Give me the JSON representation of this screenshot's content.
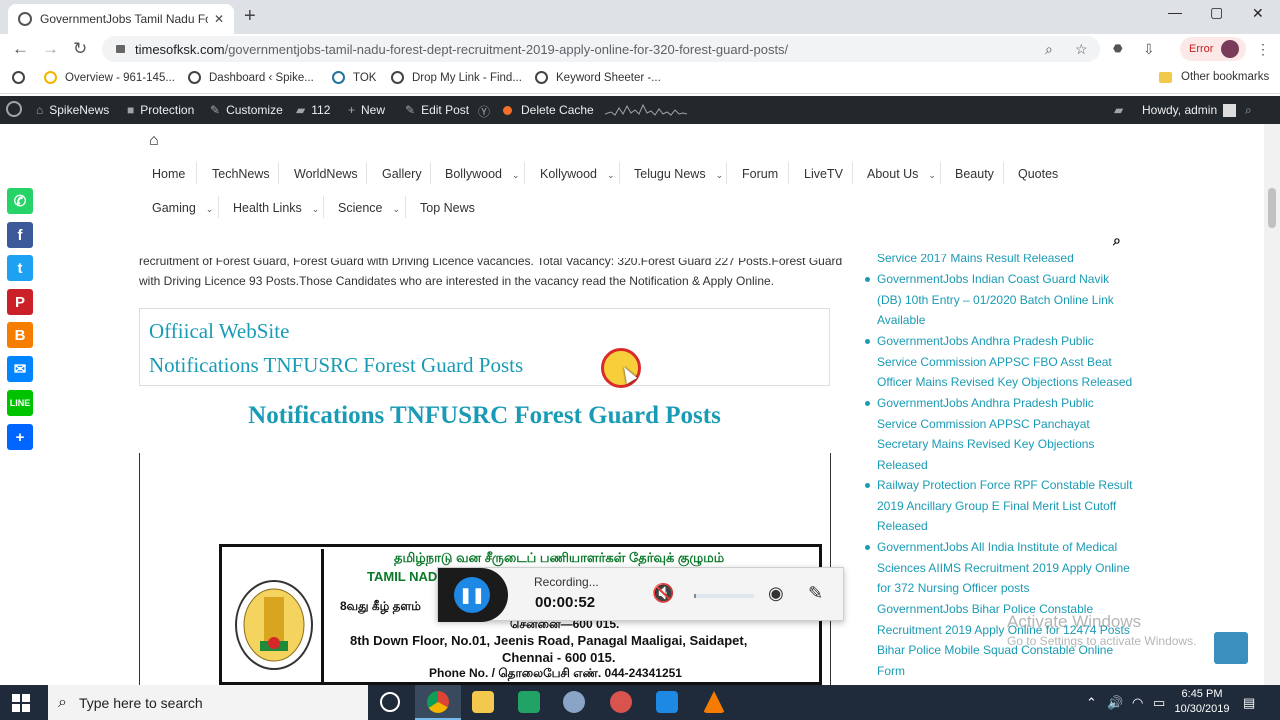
{
  "browser": {
    "tab_title": "GovernmentJobs Tamil Nadu For",
    "url_host": "timesofksk.com",
    "url_path": "/governmentjobs-tamil-nadu-forest-dept-recruitment-2019-apply-online-for-320-forest-guard-posts/",
    "error_label": "Error",
    "bookmarks": [
      "Overview - 961-145...",
      "Dashboard ‹ Spike...",
      "TOK",
      "Drop My Link - Find...",
      "Keyword Sheeter -..."
    ],
    "other_bookmarks": "Other bookmarks"
  },
  "adminbar": {
    "site": "SpikeNews",
    "protection": "Protection",
    "customize": "Customize",
    "comments": "112",
    "new": "New",
    "edit_post": "Edit Post",
    "delete_cache": "Delete Cache",
    "howdy": "Howdy, admin"
  },
  "menu": {
    "row1": [
      "Home",
      "TechNews",
      "WorldNews",
      "Gallery",
      "Bollywood",
      "Kollywood",
      "Telugu News",
      "Forum",
      "LiveTV",
      "About Us",
      "Beauty",
      "Quotes"
    ],
    "row2": [
      "Gaming",
      "Health Links",
      "Science",
      "Top News"
    ]
  },
  "article": {
    "line1": "recruitment of Forest Guard, Forest Guard with Driving Licence vacancies. Total Vacancy: 320.Forest Guard 227 Posts.Forest Guard",
    "line2": "with Driving Licence 93 Posts.Those Candidates who are interested in the vacancy read the Notification & Apply Online.",
    "official_link": "Offiical WebSite",
    "notification_link": "Notifications TNFUSRC Forest Guard Posts",
    "heading": "Notifications TNFUSRC Forest Guard Posts"
  },
  "notice": {
    "tamil_title": "தமிழ்நாடு வன சீருடைப் பணியாளர்கள் தேர்வுக் குழுமம்",
    "english_title": "TAMIL NAD",
    "floor_tamil": "8வது கீழ் தளம்",
    "city_tamil": "சென்னை—600 015.",
    "address1": "8th Down Floor, No.01, Jeenis Road, Panagal Maaligai, Saidapet,",
    "address2": "Chennai - 600 015.",
    "phone": "Phone No. / தொலைபேசி எண். 044-24341251"
  },
  "sidebar": {
    "top_partial": "Service 2017 Mains Result Released",
    "items": [
      "GovernmentJobs Indian Coast Guard Navik (DB) 10th Entry – 01/2020 Batch Online Link Available",
      "GovernmentJobs Andhra Pradesh Public Service Commission APPSC FBO Asst Beat Officer Mains Revised Key Objections Released",
      "GovernmentJobs Andhra Pradesh Public Service Commission APPSC Panchayat Secretary Mains Revised Key Objections Released",
      "Railway Protection Force RPF Constable Result 2019 Ancillary Group E Final Merit List Cutoff Released",
      "GovernmentJobs All India Institute of Medical Sciences AIIMS Recruitment 2019 Apply Online for 372 Nursing Officer posts",
      "GovernmentJobs Bihar Police Constable Recruitment 2019 Apply Online for 12474 Posts Bihar Police Mobile Squad Constable Online Form"
    ]
  },
  "recorder": {
    "status": "Recording...",
    "time": "00:00:52"
  },
  "watermark": {
    "line1": "Activate Windows",
    "line2": "Go to Settings to activate Windows."
  },
  "taskbar": {
    "search_placeholder": "Type here to search",
    "time": "6:45 PM",
    "date": "10/30/2019"
  },
  "colors": {
    "accent": "#1a9bb5",
    "adminbar": "#23282d",
    "taskbar": "#1f2b3a"
  }
}
